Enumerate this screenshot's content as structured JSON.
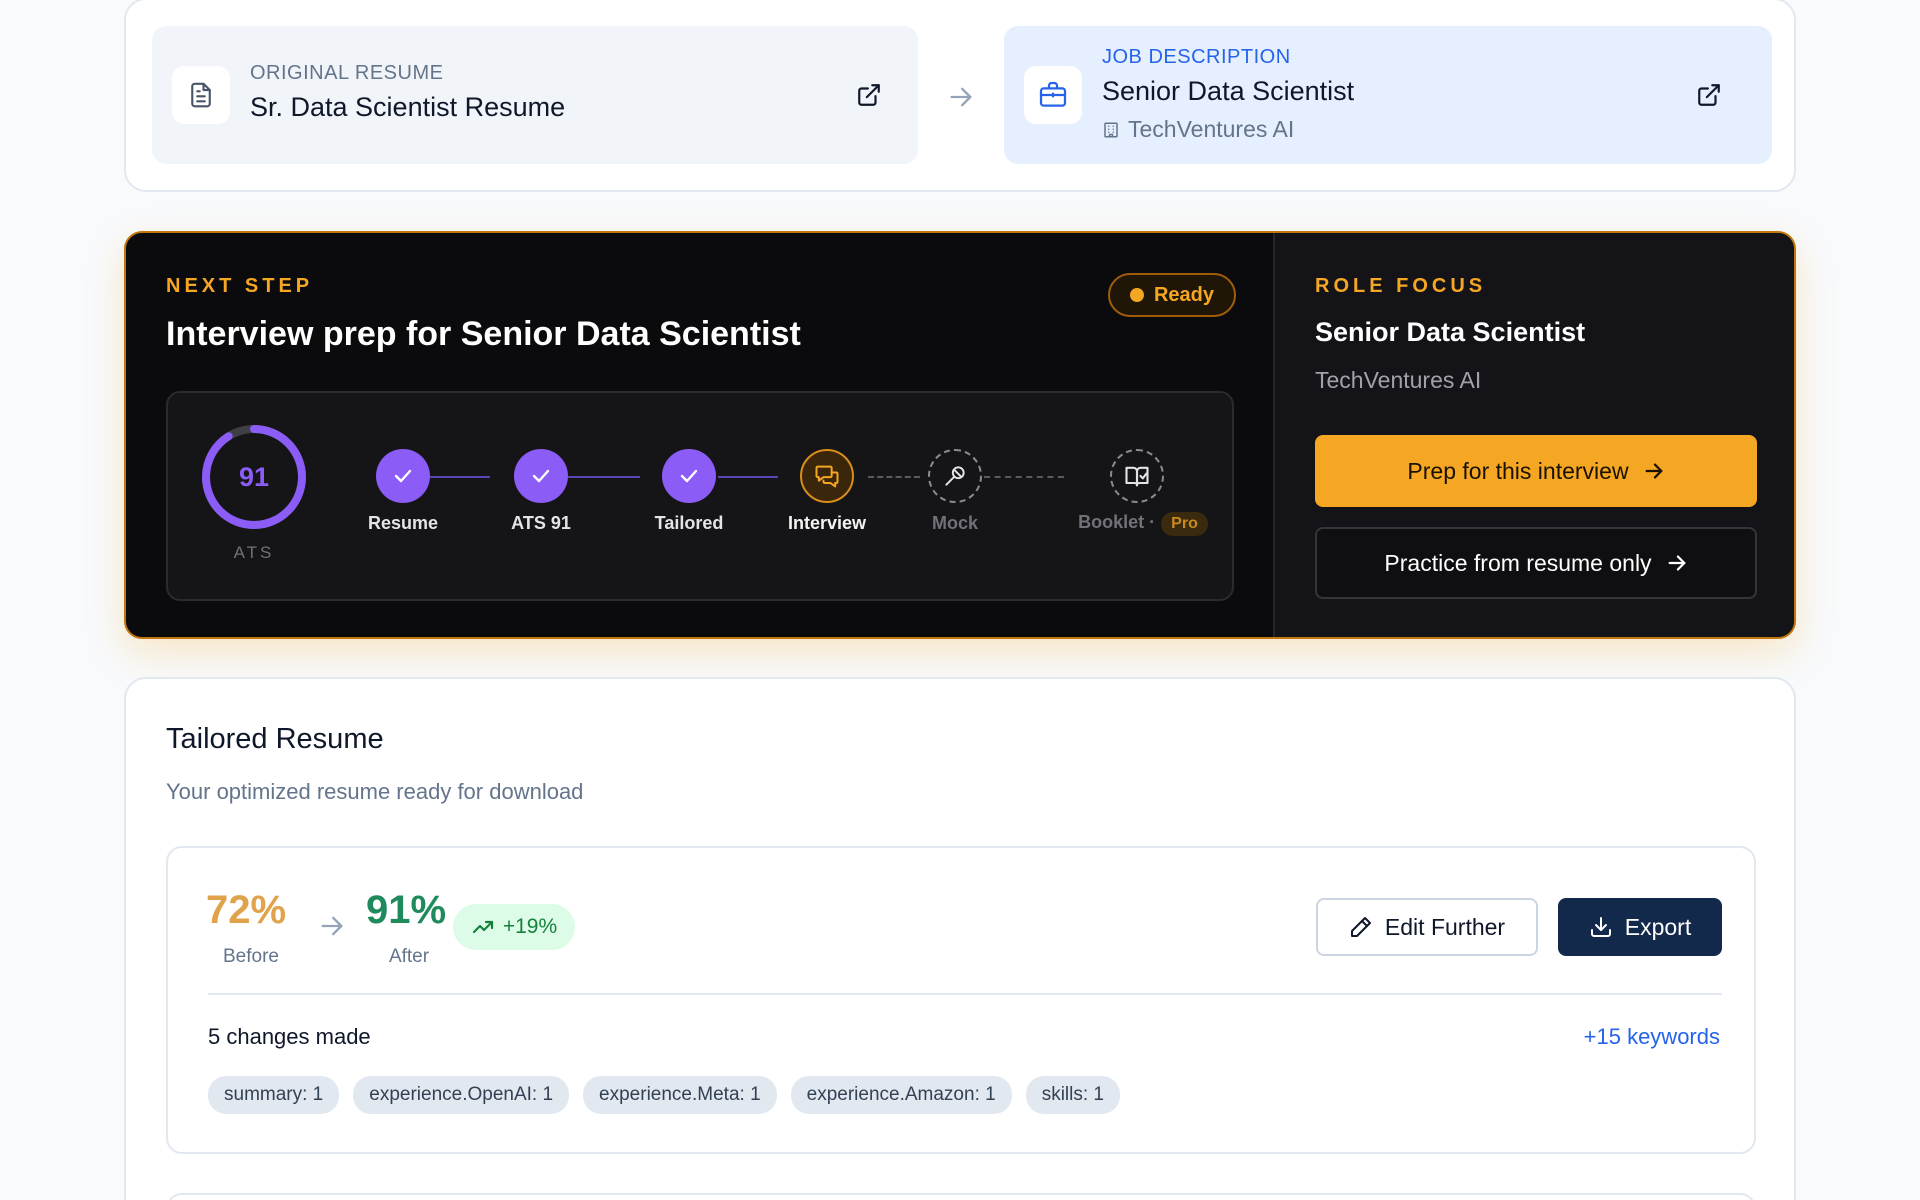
{
  "source": {
    "resume": {
      "eyebrow": "ORIGINAL RESUME",
      "title": "Sr. Data Scientist Resume",
      "icon": "document-icon"
    },
    "job": {
      "eyebrow": "JOB DESCRIPTION",
      "title": "Senior Data Scientist",
      "company": "TechVentures AI",
      "icon": "briefcase-icon"
    }
  },
  "next_step": {
    "eyebrow": "NEXT STEP",
    "title": "Interview prep for Senior Data Scientist",
    "badge": "Ready",
    "ats": {
      "score": "91",
      "label": "ATS",
      "fraction": 0.91
    },
    "steps": [
      {
        "label": "Resume",
        "state": "done"
      },
      {
        "label": "ATS 91",
        "state": "done"
      },
      {
        "label": "Tailored",
        "state": "done"
      },
      {
        "label": "Interview",
        "state": "current"
      },
      {
        "label": "Mock",
        "state": "future"
      },
      {
        "label": "Booklet ·",
        "state": "future",
        "badge": "Pro"
      }
    ]
  },
  "role_focus": {
    "eyebrow": "ROLE FOCUS",
    "title": "Senior Data Scientist",
    "company": "TechVentures AI",
    "primary_button": "Prep for this interview",
    "secondary_button": "Practice from resume only"
  },
  "tailored": {
    "title": "Tailored Resume",
    "subtitle": "Your optimized resume ready for download",
    "before": {
      "value": "72%",
      "label": "Before"
    },
    "after": {
      "value": "91%",
      "label": "After"
    },
    "delta": "+19%",
    "edit_button": "Edit Further",
    "export_button": "Export",
    "changes_count": "5 changes made",
    "keywords": "+15 keywords",
    "chips": [
      "summary: 1",
      "experience.OpenAI: 1",
      "experience.Meta: 1",
      "experience.Amazon: 1",
      "skills: 1"
    ]
  },
  "colors": {
    "accent_amber": "#f5a623",
    "accent_purple": "#8b5cf6",
    "before_color": "#e0a24a",
    "after_color": "#1f8a5b",
    "export_navy": "#13294b",
    "link_blue": "#2563eb"
  }
}
